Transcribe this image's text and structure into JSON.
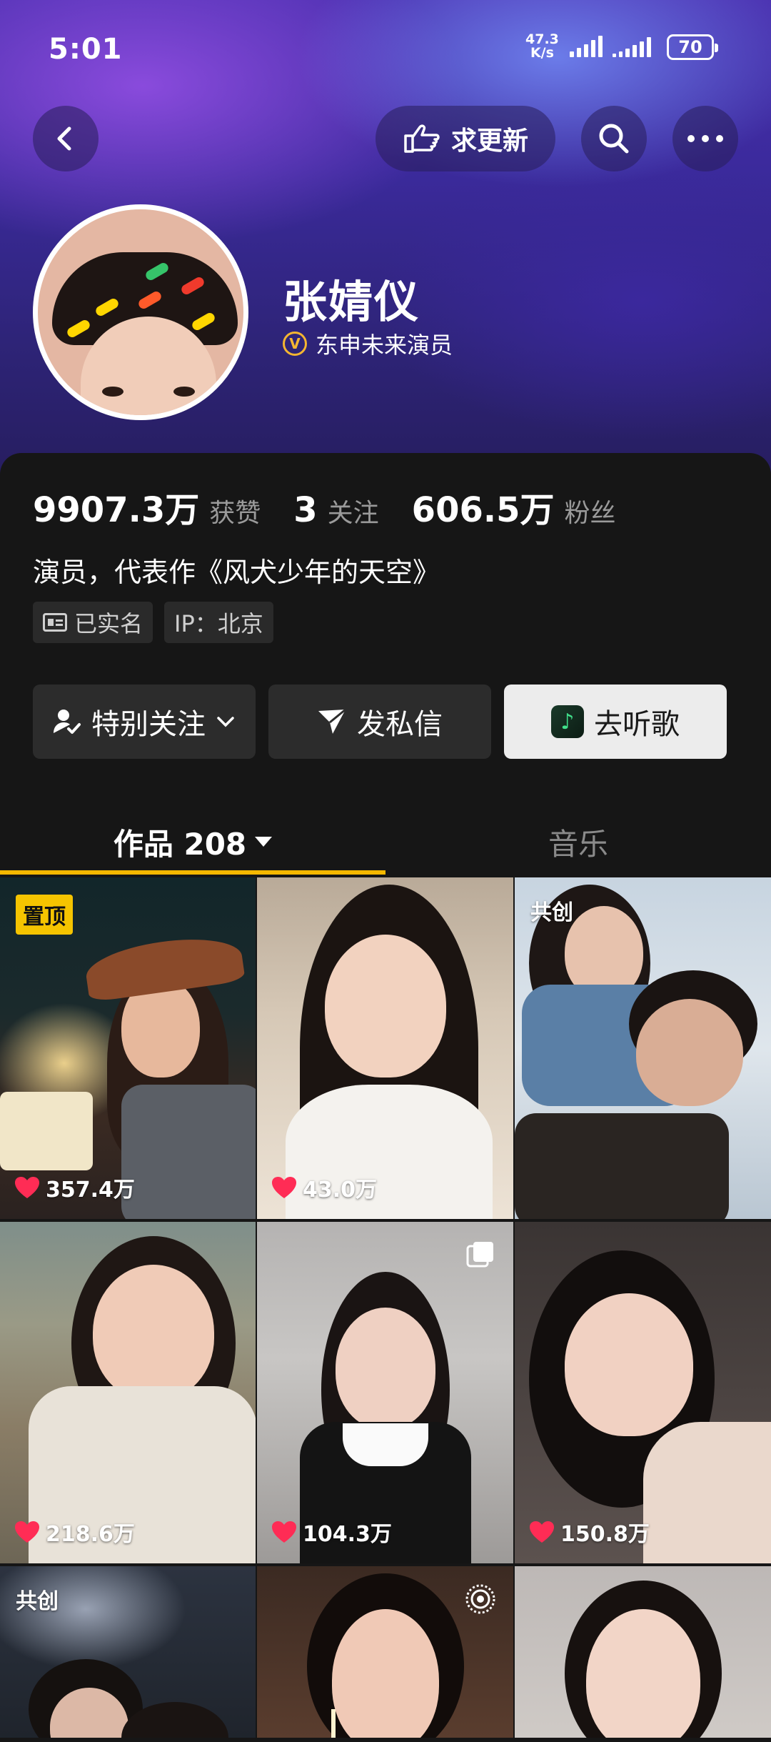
{
  "status_bar": {
    "time": "5:01",
    "net_speed_value": "47.3",
    "net_speed_unit": "K/s",
    "battery": "70"
  },
  "nav": {
    "update_label": "求更新"
  },
  "profile": {
    "name": "张婧仪",
    "verified_label": "东申未来演员",
    "verify_mark": "V"
  },
  "stats": [
    {
      "value": "9907.3万",
      "label": "获赞"
    },
    {
      "value": "3",
      "label": "关注"
    },
    {
      "value": "606.5万",
      "label": "粉丝"
    }
  ],
  "bio": "演员，代表作《风犬少年的天空》",
  "tags": {
    "realname": "已实名",
    "ip": "IP：北京"
  },
  "actions": {
    "follow_label": "特别关注",
    "message_label": "发私信",
    "listen_label": "去听歌"
  },
  "tabs": {
    "works_label": "作品 208",
    "music_label": "音乐"
  },
  "grid": {
    "pinned_label": "置顶",
    "cocreate_label": "共创",
    "likes": [
      "357.4万",
      "43.0万",
      "218.6万",
      "104.3万",
      "150.8万"
    ]
  },
  "colors": {
    "accent": "#f5b800",
    "heart": "#ff2c55",
    "verify": "#f4b531"
  }
}
